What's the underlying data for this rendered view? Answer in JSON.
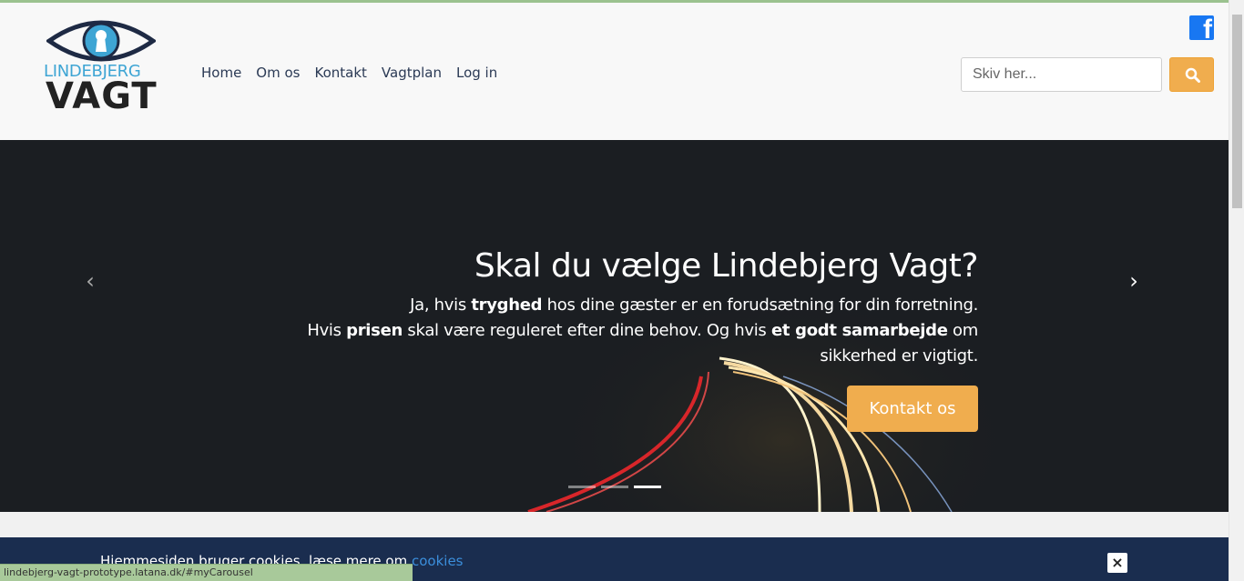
{
  "logo": {
    "line1": "LINDEBJERG",
    "line2": "VAGT",
    "eye_color": "#1e2a44",
    "iris_color": "#3ea5d4"
  },
  "nav": {
    "items": [
      {
        "label": "Home"
      },
      {
        "label": "Om os"
      },
      {
        "label": "Kontakt"
      },
      {
        "label": "Vagtplan"
      },
      {
        "label": "Log in"
      }
    ]
  },
  "social": {
    "facebook_icon": "facebook-icon",
    "facebook_glyph": "f"
  },
  "search": {
    "placeholder": "Skiv her...",
    "button_icon": "search-icon"
  },
  "carousel": {
    "title": "Skal du vælge Lindebjerg Vagt?",
    "line1_a": "Ja, hvis ",
    "line1_b": "tryghed",
    "line1_c": " hos dine gæster er en forudsætning for din forretning.",
    "line2_a": "Hvis ",
    "line2_b": "prisen",
    "line2_c": " skal være reguleret efter dine behov. Og hvis ",
    "line2_d": "et godt samarbejde",
    "line2_e": " om sikkerhed er vigtigt.",
    "cta_label": "Kontakt os",
    "prev_glyph": "‹",
    "next_glyph": "›",
    "slide_count": 3,
    "active_slide": 3
  },
  "cookie": {
    "text": "Hjemmesiden bruger cookies, læse mere om ",
    "link": "cookies",
    "close": "×"
  },
  "statusbar": {
    "url": "lindebjerg-vagt-prototype.latana.dk/#myCarousel"
  },
  "colors": {
    "accent": "#f0ad4e",
    "header_bg": "#f8f8f8",
    "cookie_bg": "#1a2d4f",
    "nav_text": "#2b3a55"
  }
}
